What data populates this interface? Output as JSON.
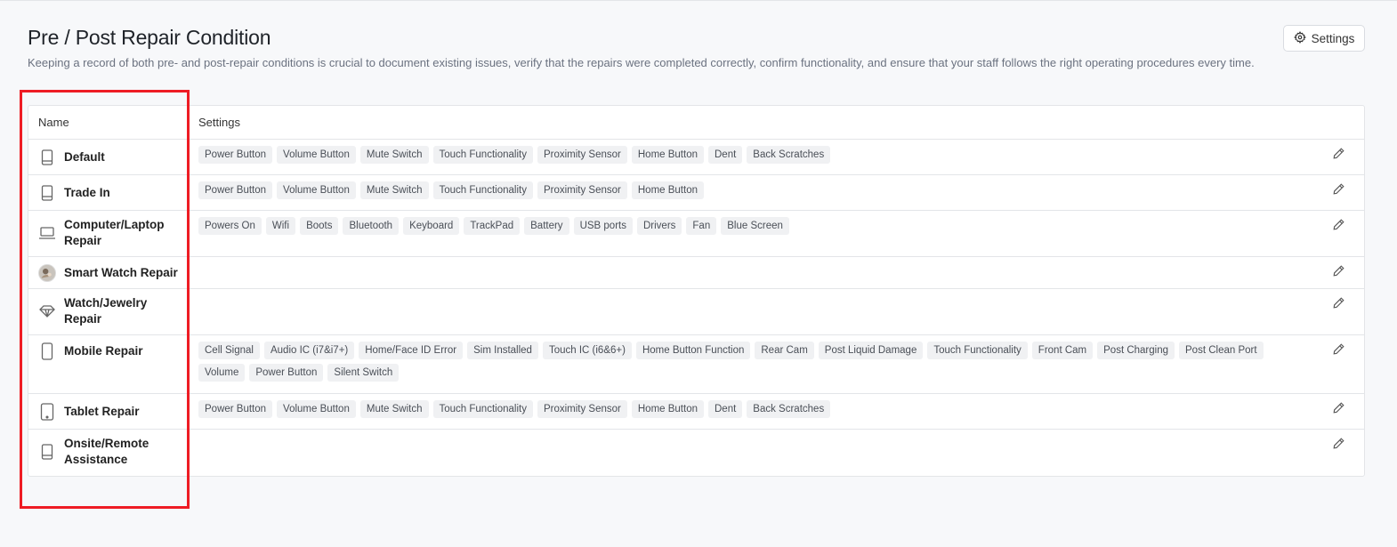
{
  "header": {
    "title": "Pre / Post Repair Condition",
    "description": "Keeping a record of both pre- and post-repair conditions is crucial to document existing issues, verify that the repairs were completed correctly, confirm functionality, and ensure that your staff follows the right operating procedures every time.",
    "settings_label": "Settings"
  },
  "table": {
    "columns": [
      "Name",
      "Settings"
    ],
    "rows": [
      {
        "name": "Default",
        "icon": "tablet-icon",
        "tags": [
          "Power Button",
          "Volume Button",
          "Mute Switch",
          "Touch Functionality",
          "Proximity Sensor",
          "Home Button",
          "Dent",
          "Back Scratches"
        ]
      },
      {
        "name": "Trade In",
        "icon": "tablet-icon",
        "tags": [
          "Power Button",
          "Volume Button",
          "Mute Switch",
          "Touch Functionality",
          "Proximity Sensor",
          "Home Button"
        ]
      },
      {
        "name": "Computer/Laptop Repair",
        "icon": "laptop-icon",
        "tags": [
          "Powers On",
          "Wifi",
          "Boots",
          "Bluetooth",
          "Keyboard",
          "TrackPad",
          "Battery",
          "USB ports",
          "Drivers",
          "Fan",
          "Blue Screen"
        ]
      },
      {
        "name": "Smart Watch Repair",
        "icon": "avatar-icon",
        "tags": []
      },
      {
        "name": "Watch/Jewelry Repair",
        "icon": "diamond-icon",
        "tags": []
      },
      {
        "name": "Mobile Repair",
        "icon": "mobile-icon",
        "tags": [
          "Cell Signal",
          "Audio IC (i7&i7+)",
          "Home/Face ID Error",
          "Sim Installed",
          "Touch IC (i6&6+)",
          "Home Button Function",
          "Rear Cam",
          "Post Liquid Damage",
          "Touch Functionality",
          "Front Cam",
          "Post Charging",
          "Post Clean Port",
          "Volume",
          "Power Button",
          "Silent Switch"
        ]
      },
      {
        "name": "Tablet Repair",
        "icon": "tablet-device-icon",
        "tags": [
          "Power Button",
          "Volume Button",
          "Mute Switch",
          "Touch Functionality",
          "Proximity Sensor",
          "Home Button",
          "Dent",
          "Back Scratches"
        ]
      },
      {
        "name": "Onsite/Remote Assistance",
        "icon": "tablet-icon",
        "tags": []
      }
    ]
  },
  "colors": {
    "highlight": "#ee1c24",
    "tag_bg": "#f0f1f3",
    "page_bg": "#f7f8fa"
  }
}
